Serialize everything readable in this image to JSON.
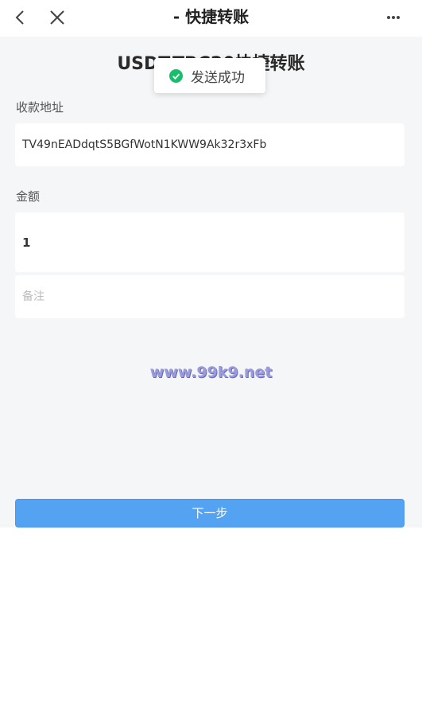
{
  "header": {
    "title": "- 快捷转账",
    "back_icon": "chevron-left-icon",
    "close_icon": "close-icon",
    "more_icon": "more-horizontal-icon"
  },
  "page": {
    "heading": "USDT-TRC20快捷转账"
  },
  "toast": {
    "message": "发送成功",
    "icon": "check-circle-icon",
    "icon_color": "#19be6b"
  },
  "form": {
    "address_label": "收款地址",
    "address_value": "TV49nEADdqtS5BGfWotN1KWW9Ak32r3xFb",
    "amount_label": "金额",
    "amount_value": "1",
    "note_placeholder": "备注",
    "note_value": ""
  },
  "watermark": "www.99k9.net",
  "actions": {
    "next_label": "下一步",
    "next_color": "#54a2f2"
  }
}
